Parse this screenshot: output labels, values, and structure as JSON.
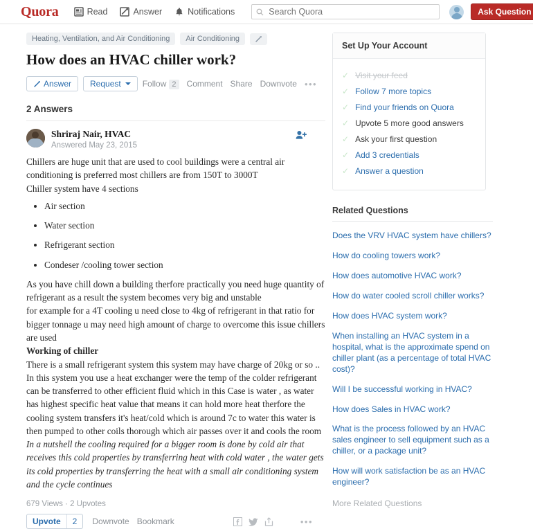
{
  "header": {
    "logo": "Quora",
    "nav": [
      {
        "label": "Read",
        "icon": "read-icon"
      },
      {
        "label": "Answer",
        "icon": "answer-pencil-icon"
      },
      {
        "label": "Notifications",
        "icon": "bell-icon"
      }
    ],
    "search": {
      "placeholder": "Search Quora",
      "value": ""
    },
    "ask_button": "Ask Question",
    "avatar": "user-avatar"
  },
  "question": {
    "tags": [
      "Heating, Ventilation, and Air Conditioning",
      "Air Conditioning"
    ],
    "title": "How does an HVAC chiller work?",
    "actions": {
      "answer": "Answer",
      "request": "Request",
      "follow": "Follow",
      "follow_count": "2",
      "comment": "Comment",
      "share": "Share",
      "downvote": "Downvote",
      "more": "•••"
    }
  },
  "answers": {
    "heading": "2 Answers",
    "author": "Shriraj Nair, HVAC",
    "date": "Answered May 23, 2015",
    "paragraphs": {
      "p1_line1": "Chillers are huge unit that are used to cool buildings were a central air conditioning is preferred most chillers are from 150T to 3000T",
      "p1_line2": "Chiller system have 4 sections",
      "bullets": [
        "Air section",
        "Water section",
        "Refrigerant section",
        "Condeser /cooling tower section"
      ],
      "p2_line1": "As you have chill down a building therfore practically you need huge quantity of refrigerant as a result the system becomes very big and unstable",
      "p2_line2": "for example for a 4T cooling u need close to 4kg of refrigerant in that ratio for bigger tonnage u may need high amount of charge to overcome this issue chillers are used",
      "heading_bold": "Working of chiller",
      "p3": "There is a small refrigerant system this system may have charge of 20kg or so .. In this system you use a heat exchanger were the temp of the colder refrigerant can be transferred to other efficient fluid which in this Case is water , as water has highest specific heat value that means it can hold more heat therfore the cooling system transfers it's heat/cold which is around 7c to water this water is then pumped to other coils thorough which air passes over it and cools the room",
      "p4_italic": "In a nutshell the cooling required for a bigger room is done by cold air that receives this cold properties by transferring heat with cold water , the water gets its cold properties by transferring the heat with a small air conditioning system and the cycle continues"
    },
    "stats": "679 Views · 2 Upvotes",
    "footer": {
      "upvote": "Upvote",
      "upvote_count": "2",
      "downvote": "Downvote",
      "bookmark": "Bookmark",
      "facebook_icon": "facebook-icon",
      "twitter_icon": "twitter-icon",
      "share_icon": "share-icon",
      "more_icon": "more-dots-icon"
    }
  },
  "sidebar": {
    "setup": {
      "title": "Set Up Your Account",
      "items": [
        {
          "label": "Visit your feed",
          "style": "done"
        },
        {
          "label": "Follow 7 more topics",
          "style": "link"
        },
        {
          "label": "Find your friends on Quora",
          "style": "link"
        },
        {
          "label": "Upvote 5 more good answers",
          "style": "dark"
        },
        {
          "label": "Ask your first question",
          "style": "dark"
        },
        {
          "label": "Add 3 credentials",
          "style": "link"
        },
        {
          "label": "Answer a question",
          "style": "link"
        }
      ]
    },
    "related": {
      "title": "Related Questions",
      "items": [
        "Does the VRV HVAC system have chillers?",
        "How do cooling towers work?",
        "How does automotive HVAC work?",
        "How do water cooled scroll chiller works?",
        "How does HVAC system work?",
        "When installing an HVAC system in a hospital, what is the approximate spend on chiller plant (as a percentage of total HVAC cost)?",
        "Will I be successful working in HVAC?",
        "How does Sales in HVAC work?",
        "What is the process followed by an HVAC sales engineer to sell equipment such as a chiller, or a package unit?",
        "How will work satisfaction be as an HVAC engineer?"
      ],
      "more": "More Related Questions"
    }
  },
  "colors": {
    "brand_red": "#b92b27",
    "link_blue": "#2b6dad",
    "muted_gray": "#9ba0a5",
    "tag_bg": "#eff1f3"
  }
}
